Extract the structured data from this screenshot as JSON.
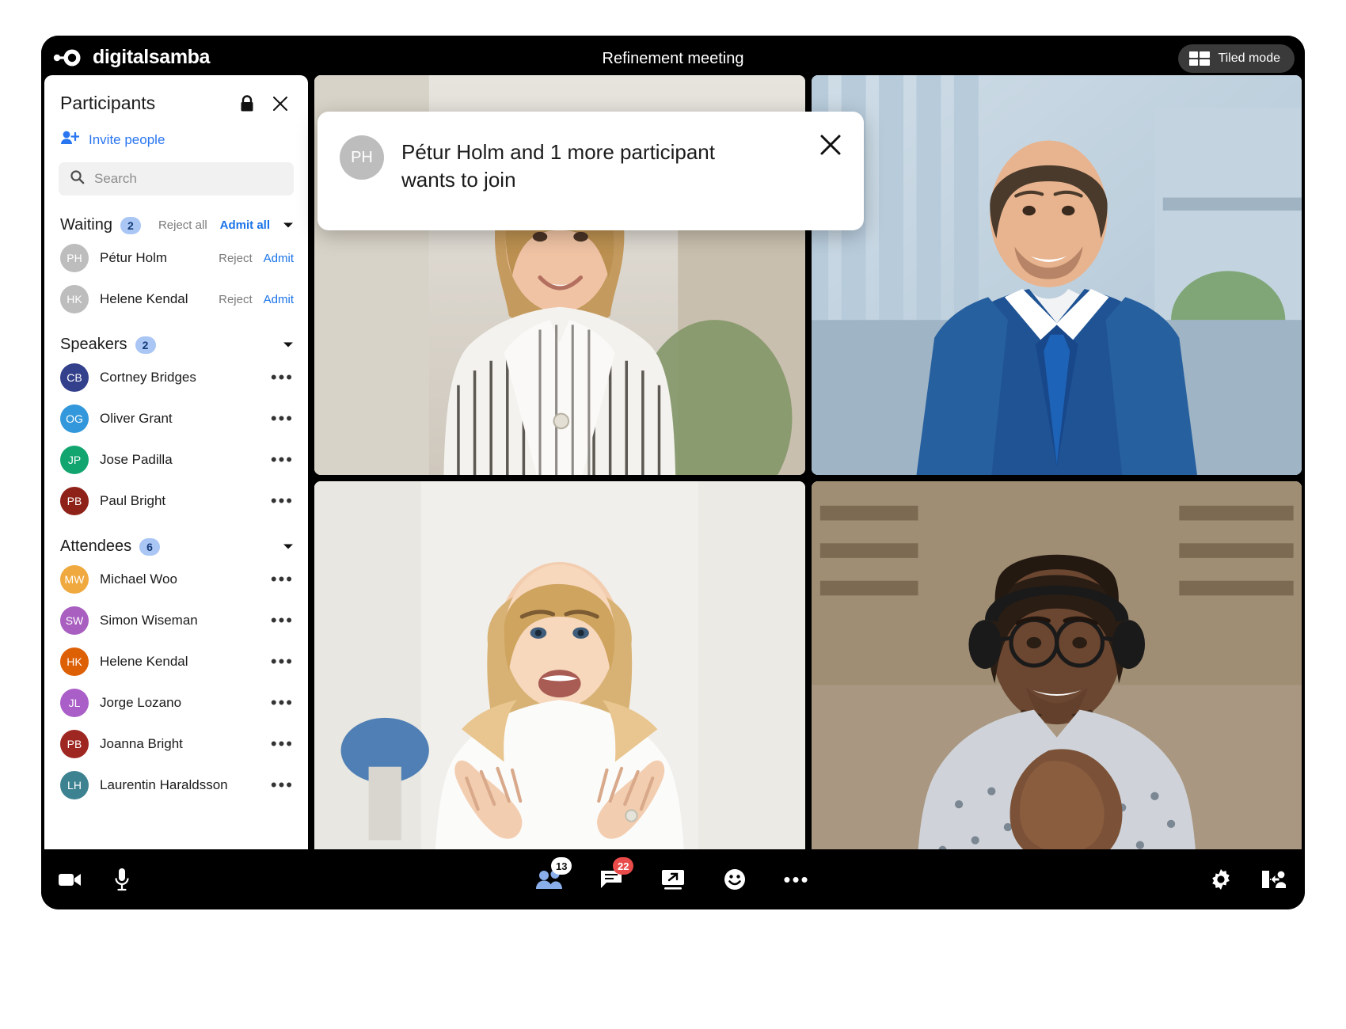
{
  "brand": {
    "name": "digitalsamba",
    "logo_icon": "digitalsamba-logo-icon"
  },
  "header": {
    "meeting_title": "Refinement meeting",
    "tiled_mode_label": "Tiled mode",
    "tiled_mode_icon": "grid-tiles-icon"
  },
  "panel": {
    "title": "Participants",
    "lock_icon": "lock-icon",
    "close_icon": "close-icon",
    "invite_label": "Invite people",
    "invite_icon": "person-add-icon",
    "search_placeholder": "Search",
    "search_value": "",
    "search_icon": "search-icon",
    "accent_color": "#1a73e8",
    "sections": [
      {
        "key": "waiting",
        "name": "Waiting",
        "count": "2",
        "reject_all_label": "Reject all",
        "admit_all_label": "Admit all",
        "caret_icon": "chevron-down-icon",
        "people": [
          {
            "initials": "PH",
            "name": "Pétur Holm",
            "color": "#bdbdbd",
            "reject_label": "Reject",
            "admit_label": "Admit"
          },
          {
            "initials": "HK",
            "name": "Helene Kendal",
            "color": "#bdbdbd",
            "reject_label": "Reject",
            "admit_label": "Admit"
          }
        ]
      },
      {
        "key": "speakers",
        "name": "Speakers",
        "count": "2",
        "caret_icon": "chevron-down-icon",
        "people": [
          {
            "initials": "CB",
            "name": "Cortney Bridges",
            "color": "#33408c",
            "menu_icon": "more-options-icon"
          },
          {
            "initials": "OG",
            "name": "Oliver Grant",
            "color": "#3398db",
            "menu_icon": "more-options-icon"
          },
          {
            "initials": "JP",
            "name": "Jose Padilla",
            "color": "#12a56f",
            "menu_icon": "more-options-icon"
          },
          {
            "initials": "PB",
            "name": "Paul Bright",
            "color": "#8f2218",
            "menu_icon": "more-options-icon"
          }
        ]
      },
      {
        "key": "attendees",
        "name": "Attendees",
        "count": "6",
        "caret_icon": "chevron-down-icon",
        "people": [
          {
            "initials": "MW",
            "name": "Michael Woo",
            "color": "#f0a93e",
            "menu_icon": "more-options-icon"
          },
          {
            "initials": "SW",
            "name": "Simon Wiseman",
            "color": "#a85fc0",
            "menu_icon": "more-options-icon"
          },
          {
            "initials": "HK",
            "name": "Helene Kendal",
            "color": "#dd6005",
            "menu_icon": "more-options-icon"
          },
          {
            "initials": "JL",
            "name": "Jorge Lozano",
            "color": "#aa5ec8",
            "menu_icon": "more-options-icon"
          },
          {
            "initials": "PB",
            "name": "Joanna Bright",
            "color": "#9e2721",
            "menu_icon": "more-options-icon"
          },
          {
            "initials": "LH",
            "name": "Laurentin Haraldsson",
            "color": "#3d8290",
            "menu_icon": "more-options-icon"
          }
        ]
      }
    ]
  },
  "join_modal": {
    "avatar_initials": "PH",
    "message": "Pétur Holm and 1 more participant wants to join",
    "close_icon": "close-icon"
  },
  "video_grid": {
    "tiles": [
      {
        "id": "tile-1",
        "person": "woman-striped-shirt"
      },
      {
        "id": "tile-2",
        "person": "man-blue-suit"
      },
      {
        "id": "tile-3",
        "person": "woman-white-top"
      },
      {
        "id": "tile-4",
        "person": "man-headset"
      }
    ]
  },
  "toolbar": {
    "left": [
      {
        "name": "camera-icon",
        "label": "Camera"
      },
      {
        "name": "microphone-icon",
        "label": "Microphone"
      }
    ],
    "center": [
      {
        "name": "participants-icon",
        "label": "Participants",
        "badge": "13",
        "badge_style": "light"
      },
      {
        "name": "chat-icon",
        "label": "Chat",
        "badge": "22",
        "badge_style": "alert"
      },
      {
        "name": "screen-share-icon",
        "label": "Share screen"
      },
      {
        "name": "emoji-icon",
        "label": "Reactions"
      },
      {
        "name": "more-options-icon",
        "label": "More options"
      }
    ],
    "right": [
      {
        "name": "gear-icon",
        "label": "Settings"
      },
      {
        "name": "leave-meeting-icon",
        "label": "Leave meeting"
      }
    ]
  }
}
